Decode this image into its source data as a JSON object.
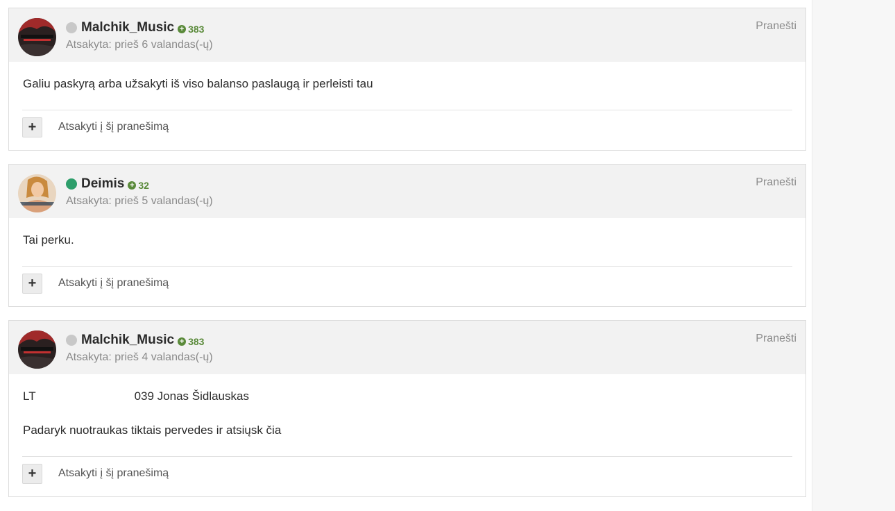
{
  "posts": [
    {
      "author": "Malchik_Music",
      "reputation": "383",
      "status": "offline",
      "status_color": "#c8c8c8",
      "avatar": "admin-avatar-red",
      "reply_time": "Atsakyta: prieš 6 valandas(-ų)",
      "report_label": "Pranešti",
      "lines": [
        "Galiu paskyrą arba užsakyti iš viso balanso paslaugą ir perleisti tau"
      ],
      "reply_label": "Atsakyti į šį pranešimą"
    },
    {
      "author": "Deimis",
      "reputation": "32",
      "status": "online",
      "status_color": "#2e9e6b",
      "avatar": "photo-avatar",
      "reply_time": "Atsakyta: prieš 5 valandas(-ų)",
      "report_label": "Pranešti",
      "lines": [
        "Tai perku."
      ],
      "reply_label": "Atsakyti į šį pranešimą"
    },
    {
      "author": "Malchik_Music",
      "reputation": "383",
      "status": "offline",
      "status_color": "#c8c8c8",
      "avatar": "admin-avatar-red",
      "reply_time": "Atsakyta: prieš 4 valandas(-ų)",
      "report_label": "Pranešti",
      "iban_prefix": "LT",
      "iban_suffix": "039 Jonas Šidlauskas",
      "lines": [
        "Padaryk nuotraukas tiktais pervedes ir atsiųsk čia"
      ],
      "reply_label": "Atsakyti į šį pranešimą"
    }
  ],
  "reply_button_icon": "plus-icon",
  "reply_button_symbol": "+"
}
